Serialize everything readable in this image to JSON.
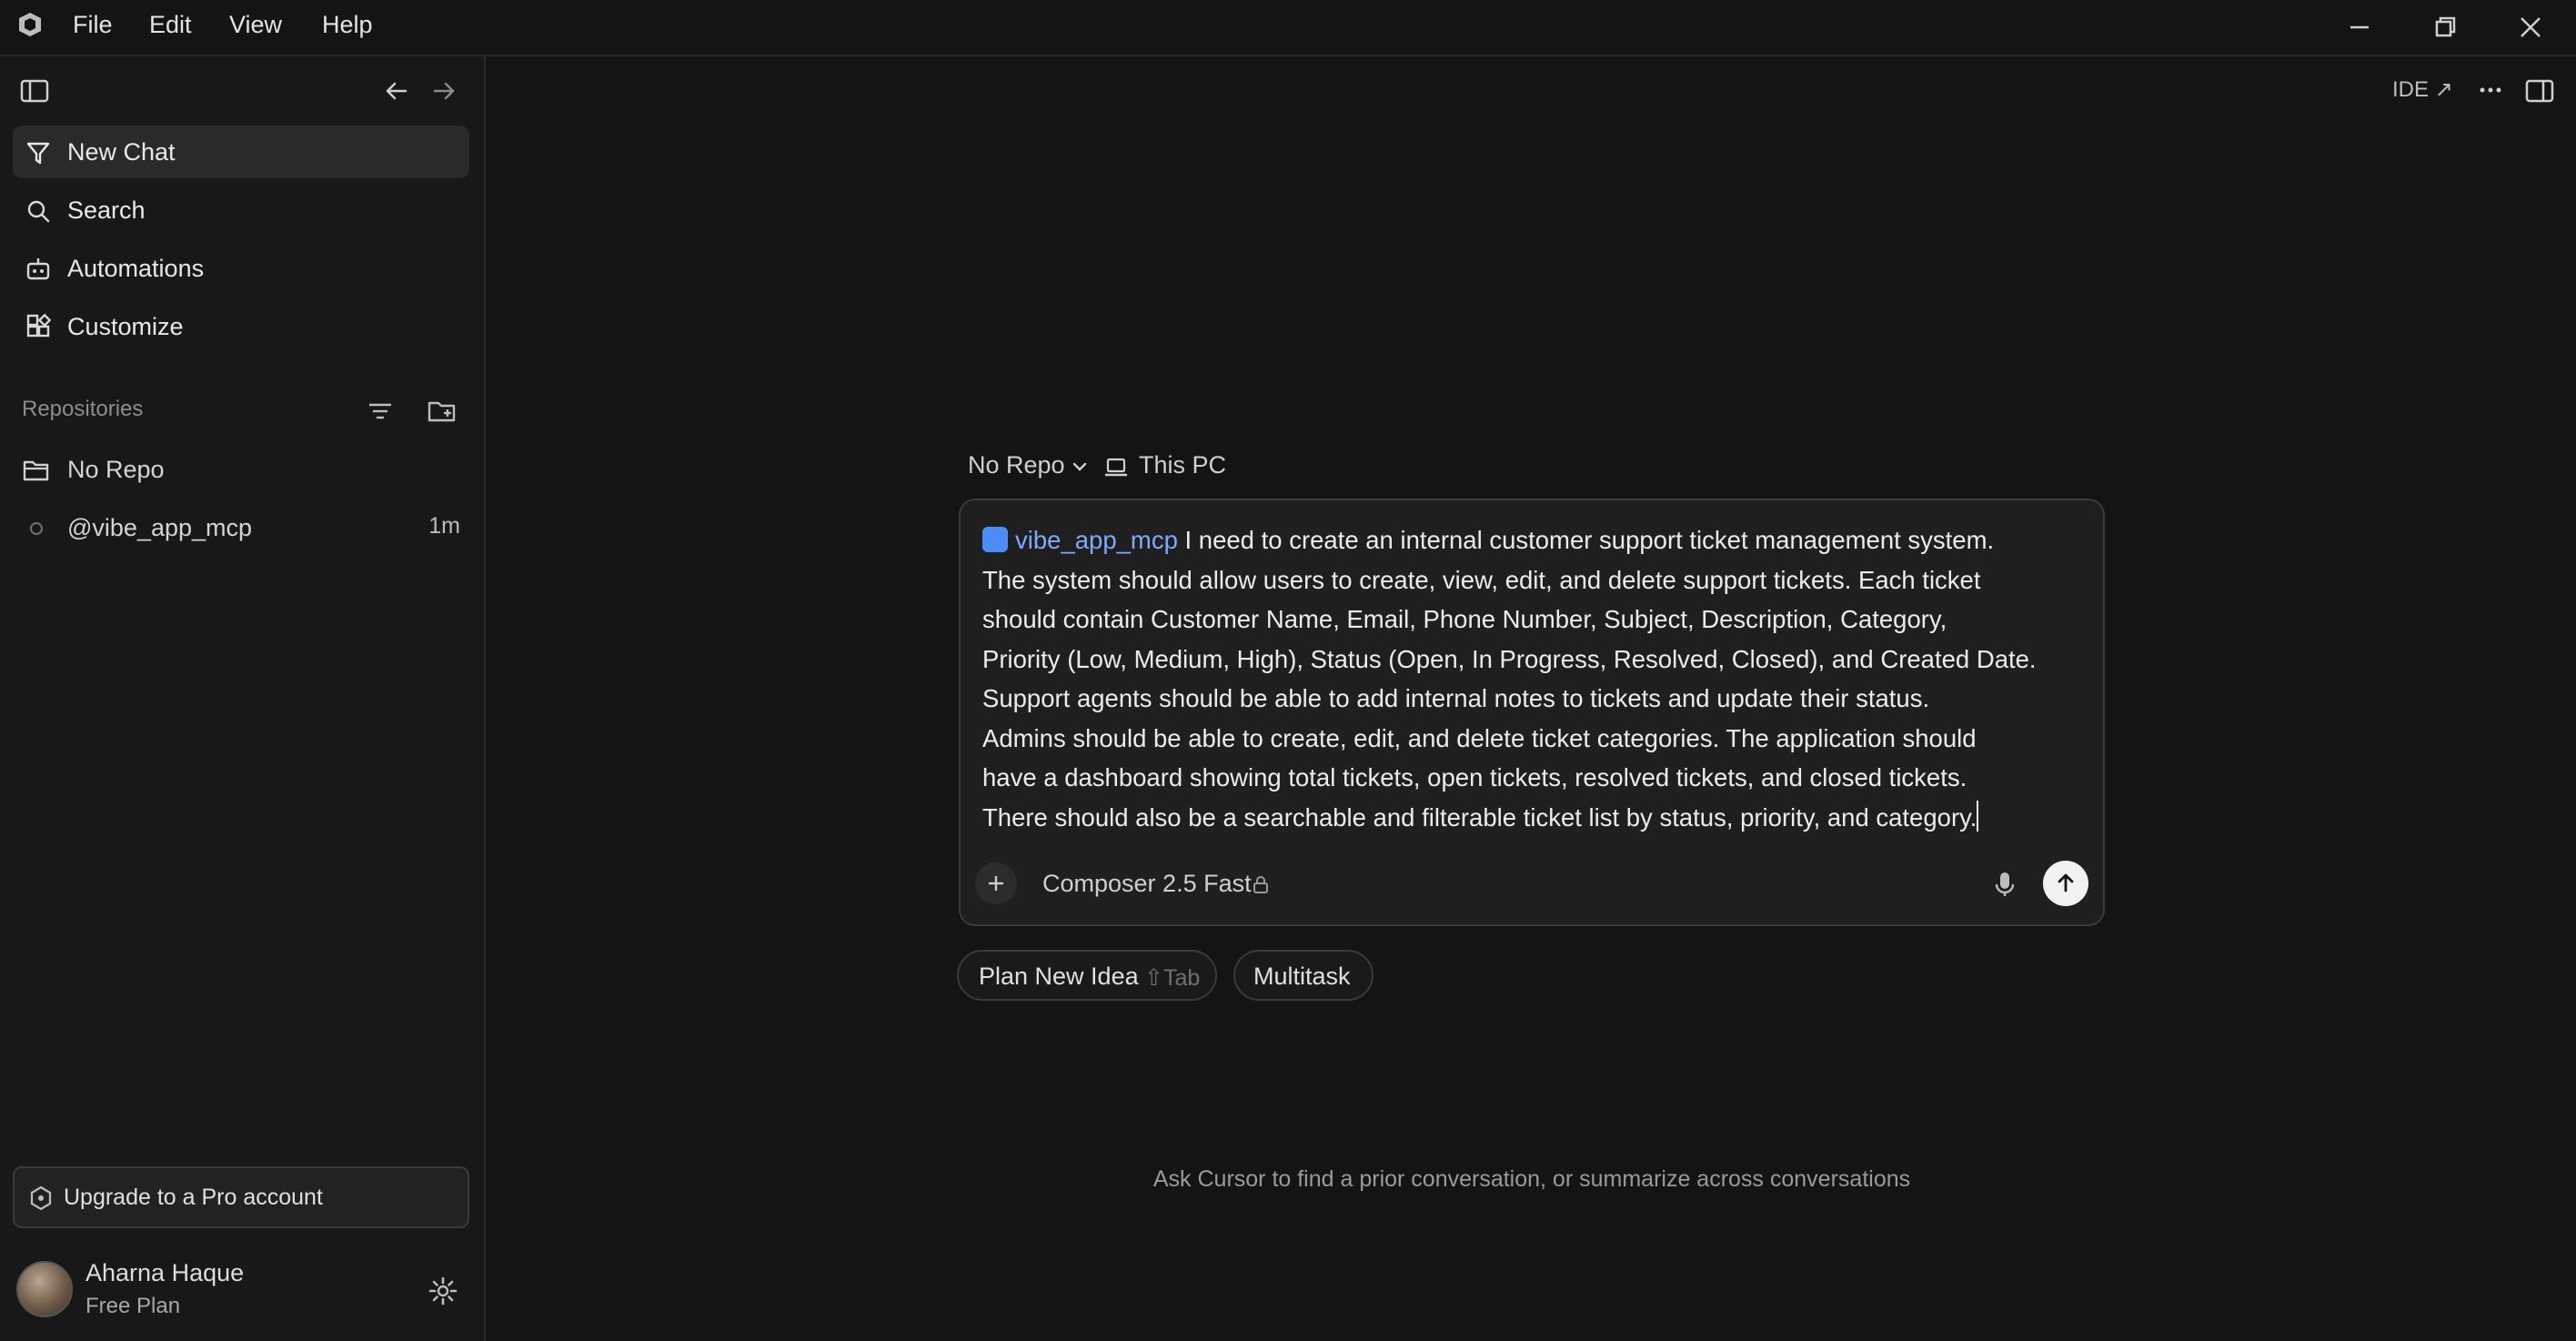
{
  "menu": [
    "File",
    "Edit",
    "View",
    "Help"
  ],
  "sidebar": {
    "nav": [
      {
        "label": "New Chat",
        "icon": "new-chat-icon"
      },
      {
        "label": "Search",
        "icon": "search-icon"
      },
      {
        "label": "Automations",
        "icon": "robot-icon"
      },
      {
        "label": "Customize",
        "icon": "widgets-icon"
      }
    ],
    "repositories_label": "Repositories",
    "repos": [
      {
        "label": "No Repo",
        "icon": "folder-icon",
        "time": ""
      },
      {
        "label": "@vibe_app_mcp",
        "icon": "circle-icon",
        "time": "1m"
      }
    ],
    "upgrade_label": "Upgrade to a Pro account",
    "user": {
      "name": "Aharna Haque",
      "plan": "Free Plan"
    }
  },
  "header": {
    "ide_label": "IDE ↗"
  },
  "context": {
    "repo": "No Repo",
    "location": "This PC"
  },
  "composer": {
    "mention": "vibe_app_mcp",
    "prompt_lines": [
      " I need to create an internal customer support ticket management system.",
      "The system should allow users to create, view, edit, and delete support tickets. Each ticket",
      "should contain Customer Name, Email, Phone Number, Subject, Description, Category,",
      "Priority (Low, Medium, High), Status (Open, In Progress, Resolved, Closed), and Created Date.",
      "Support agents should be able to add internal notes to tickets and update their status.",
      "Admins should be able to create, edit, and delete ticket categories. The application should",
      "have a dashboard showing total tickets, open tickets, resolved tickets, and closed tickets.",
      "There should also be a searchable and filterable ticket list by status, priority, and category."
    ],
    "model": "Composer 2.5 Fast"
  },
  "pills": {
    "plan_label": "Plan New Idea",
    "plan_hint": "⇧Tab",
    "multitask_label": "Multitask"
  },
  "footer_hint": "Ask Cursor to find a prior conversation, or summarize across conversations"
}
